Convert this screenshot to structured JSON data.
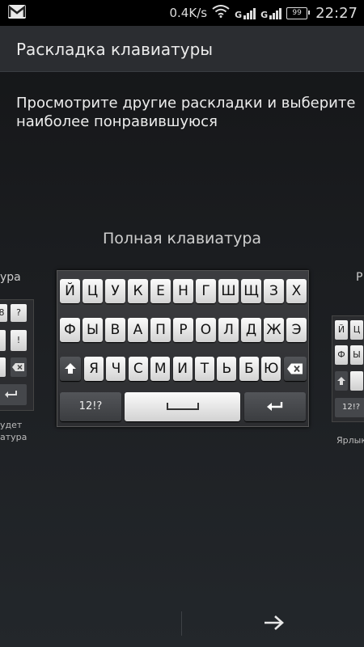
{
  "status_bar": {
    "net_speed": "0.4K/s",
    "signal1_label": "G",
    "signal2_label": "G",
    "battery": "99",
    "time": "22:27",
    "icons": [
      "gmail-icon",
      "wifi-icon",
      "signal-icon",
      "signal-icon",
      "battery-icon"
    ]
  },
  "header": {
    "title": "Раскладка клавиатуры"
  },
  "instruction": "Просмотрите другие раскладки и выберите наиболее понравившуюся",
  "current_layout": {
    "name": "Полная клавиатура",
    "rows": [
      [
        "Й",
        "Ц",
        "У",
        "К",
        "Е",
        "Н",
        "Г",
        "Ш",
        "Щ",
        "З",
        "Х"
      ],
      [
        "Ф",
        "Ы",
        "В",
        "А",
        "П",
        "Р",
        "О",
        "Л",
        "Д",
        "Ж",
        "Э"
      ],
      [
        "Я",
        "Ч",
        "С",
        "М",
        "И",
        "Т",
        "Ь",
        "Б",
        "Ю"
      ]
    ],
    "symbols_key": "12!?"
  },
  "left_preview": {
    "label_tail": "ура",
    "mini_keys": [
      "8",
      "?",
      "!"
    ],
    "caption_line1": "удет",
    "caption_line2": "атура"
  },
  "right_preview": {
    "label_head": "Р",
    "mini_keys": [
      "Й",
      "Ц",
      "Ф",
      "Ы"
    ],
    "symbols_key": "12!?",
    "caption": "Ярлык"
  },
  "colors": {
    "background_top": "#141517",
    "background_bottom": "#23272b",
    "title_bar": "#2b2d31",
    "key_light": "#f0f0f0",
    "key_dark": "#45474b"
  }
}
